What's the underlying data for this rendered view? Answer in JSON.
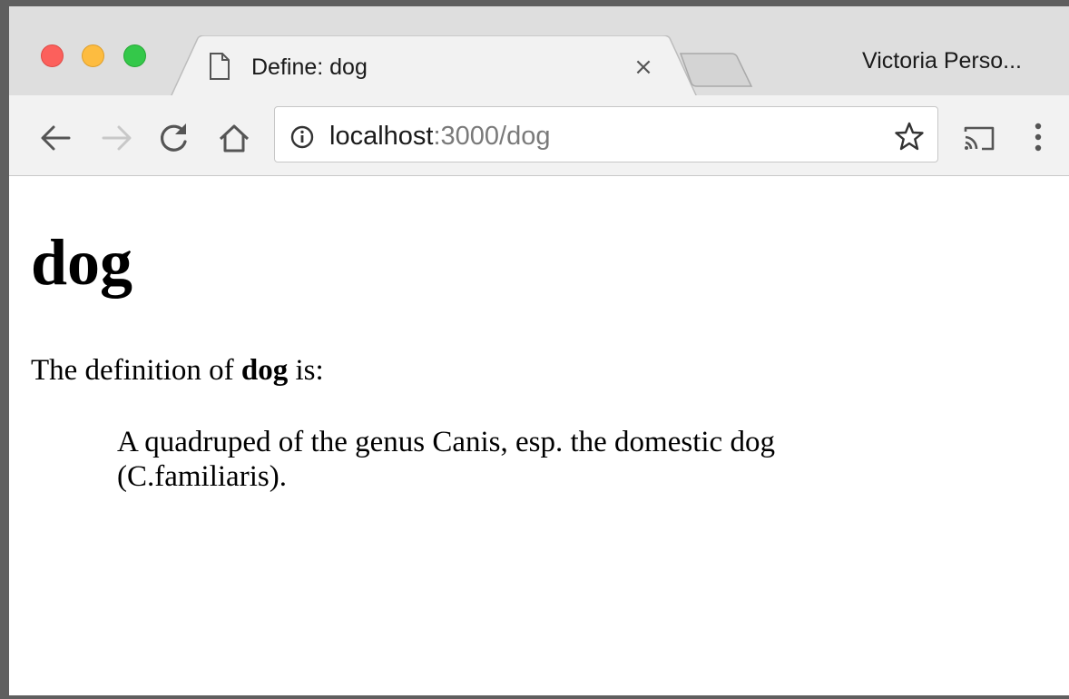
{
  "window": {
    "controls": [
      "close",
      "minimize",
      "zoom"
    ]
  },
  "tab": {
    "title": "Define: dog",
    "close_label": "×",
    "icon": "page-icon"
  },
  "profile": {
    "name": "Victoria Perso..."
  },
  "toolbar": {
    "back_icon": "arrow-left-icon",
    "forward_icon": "arrow-right-icon",
    "reload_icon": "reload-icon",
    "home_icon": "home-icon",
    "bookmark_icon": "star-icon",
    "cast_icon": "cast-icon",
    "menu_icon": "kebab-menu-icon"
  },
  "address_bar": {
    "host": "localhost",
    "path": ":3000/dog",
    "security_icon": "info-icon"
  },
  "page": {
    "heading": "dog",
    "intro_prefix": "The definition of ",
    "intro_word": "dog",
    "intro_suffix": " is:",
    "definition": "A quadruped of the genus Canis, esp. the domestic dog (C.familiaris)."
  },
  "colors": {
    "titlebar": "#dedede",
    "toolbar": "#f2f2f2",
    "close_dot": "#fc605c",
    "minimize_dot": "#fdbc40",
    "zoom_dot": "#34c84a",
    "url_path": "#7a7a7a",
    "forward_disabled": "#c8c8c8"
  }
}
